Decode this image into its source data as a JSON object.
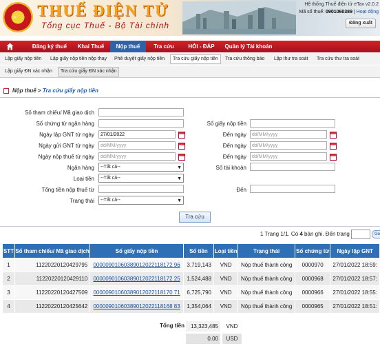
{
  "header": {
    "brand": "THUẾ ĐIỆN TỬ",
    "subtitle": "Tổng cục Thuế - Bộ Tài chính",
    "system_name": "Hệ thống Thuế điện tử eTax v2.0.2",
    "tax_id_label": "Mã số thuế:",
    "tax_id_value": "0901060389",
    "activity_link": "Hoạt động",
    "logout_label": "Đăng xuất",
    "colors": {
      "brand": "#f6a11c",
      "accent": "#b5121b"
    }
  },
  "navbar": {
    "home_icon": "home-icon",
    "items": [
      {
        "label": "Đăng ký thuế"
      },
      {
        "label": "Khai Thuế"
      },
      {
        "label": "Nộp thuế"
      },
      {
        "label": "Tra cứu"
      },
      {
        "label": "HỎI - ĐÁP"
      },
      {
        "label": "Quản lý Tài khoản"
      }
    ],
    "active": "Nộp thuế",
    "colors": {
      "bar": "#c0181f",
      "active": "#2f63a8"
    }
  },
  "submenu": {
    "row1": [
      {
        "label": "Lập giấy nộp tiền"
      },
      {
        "label": "Lập giấy nộp tiền nộp thay"
      },
      {
        "label": "Phê duyệt giấy nộp tiền"
      },
      {
        "label": "Tra cứu giấy nộp tiền"
      },
      {
        "label": "Tra cứu thông báo"
      },
      {
        "label": "Lập thư tra soát"
      },
      {
        "label": "Tra cứu thư tra soát"
      }
    ],
    "row2": [
      {
        "label": "Lập giấy ĐN xác nhận"
      },
      {
        "label": "Tra cứu giấy ĐN xác nhận"
      }
    ]
  },
  "breadcrumb": {
    "parent": "Nộp thuế",
    "separator": ">",
    "current": "Tra cứu giấy nộp tiền"
  },
  "form": {
    "ref_label": "Số tham chiếu/ Mã giao dịch",
    "ref_value": "",
    "bank_doc_label": "Số chứng từ ngân hàng",
    "bank_doc_value": "",
    "payment_no_label": "Số giấy nộp tiền",
    "payment_no_value": "",
    "created_from_label": "Ngày lập GNT từ ngày",
    "created_from_value": "27/01/2022",
    "created_to_label": "Đến ngày",
    "created_to_placeholder": "dd/MM/yyyy",
    "sent_from_label": "Ngày gửi GNT từ ngày",
    "sent_from_placeholder": "dd/MM/yyyy",
    "sent_to_label": "Đến ngày",
    "sent_to_placeholder": "dd/MM/yyyy",
    "paid_from_label": "Ngày nộp thuế từ ngày",
    "paid_from_placeholder": "dd/MM/yyyy",
    "paid_to_label": "Đến ngày",
    "paid_to_placeholder": "dd/MM/yyyy",
    "bank_label": "Ngân hàng",
    "bank_value": "--Tất cả--",
    "account_label": "Số tài khoản",
    "account_value": "",
    "currency_label": "Loại tiền",
    "currency_value": "--Tất cả--",
    "amount_from_label": "Tổng tiền nộp thuế từ",
    "amount_from_value": "",
    "amount_to_label": "Đến",
    "amount_to_value": "",
    "status_label": "Trạng thái",
    "status_value": "--Tất cả--",
    "search_button": "Tra cứu"
  },
  "paging": {
    "text_prefix": "1  Trang 1/1. Có ",
    "count": "4",
    "text_suffix": " bản ghi. Đến trang",
    "go_label": "Go"
  },
  "table": {
    "headers": [
      "STT",
      "Số tham chiếu/ Mã giao dịch",
      "Số giấy nộp tiền",
      "Số tiền",
      "Loại tiền",
      "Trạng thái",
      "Số chứng từ",
      "Ngày lập GNT"
    ],
    "rows": [
      {
        "stt": "1",
        "ref": "11220220120429795",
        "doc": "00000901060389012022118172 96",
        "amount": "3,719,143",
        "currency": "VND",
        "status": "Nộp thuế thành công",
        "voucher": "0000970",
        "date": "27/01/2022 18:59:"
      },
      {
        "stt": "2",
        "ref": "11220220120429110",
        "doc": "00000901060389012022118172 25",
        "amount": "1,524,488",
        "currency": "VND",
        "status": "Nộp thuế thành công",
        "voucher": "0000968",
        "date": "27/01/2022 18:57:"
      },
      {
        "stt": "3",
        "ref": "11220220120427509",
        "doc": "00000901060389012022118170 71",
        "amount": "6,725,790",
        "currency": "VND",
        "status": "Nộp thuế thành công",
        "voucher": "0000966",
        "date": "27/01/2022 18:55:"
      },
      {
        "stt": "4",
        "ref": "11220220120425642",
        "doc": "00000901060389012022118168 83",
        "amount": "1,354,064",
        "currency": "VND",
        "status": "Nộp thuế thành công",
        "voucher": "0000965",
        "date": "27/01/2022 18:51:"
      }
    ],
    "colors": {
      "header": "#2e6fb6"
    }
  },
  "totals": {
    "label": "Tổng tiền",
    "vnd_value": "13,323,485",
    "vnd_currency": "VND",
    "usd_value": "0.00",
    "usd_currency": "USD"
  }
}
